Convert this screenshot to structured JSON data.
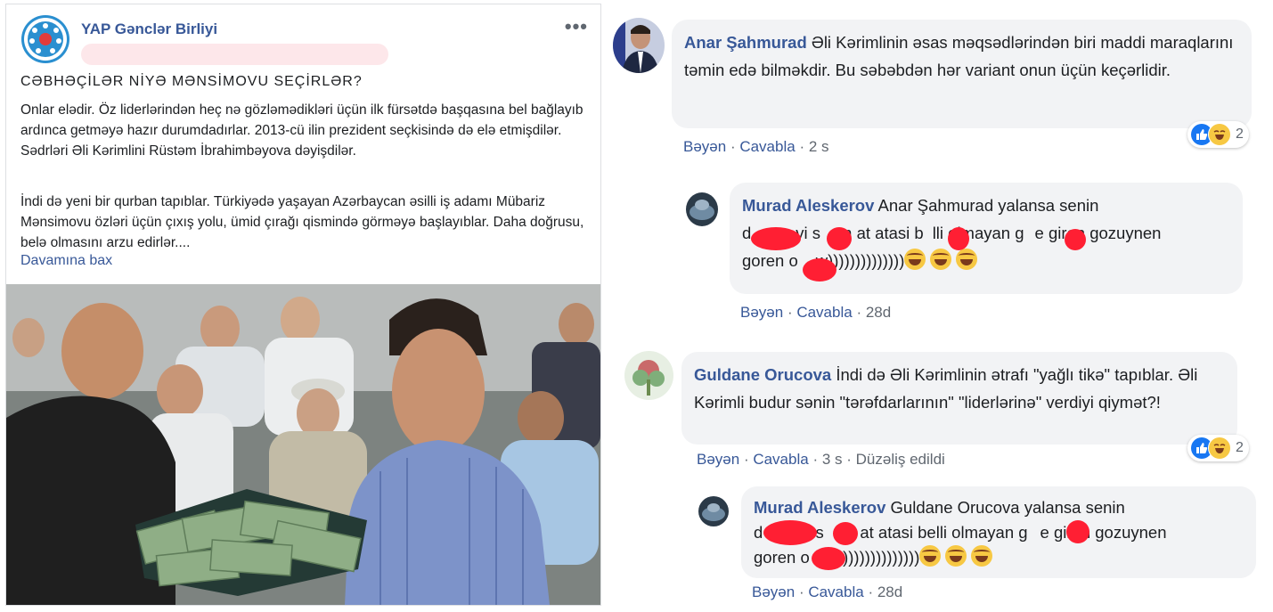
{
  "post": {
    "page_name": "YAP Gənclər Birliyi",
    "more_icon": "more-horizontal-icon",
    "headline": "CƏBHƏÇİLƏR NİYƏ MƏNSİMOVU SEÇİRLƏR?",
    "paragraph1": "Onlar elədir. Öz liderlərindən heç nə gözləmədikləri üçün ilk fürsətdə başqasına bel bağlayıb ardınca getməyə hazır durumdadırlar. 2013-cü ilin prezident seçkisində də elə etmişdilər. Sədrləri Əli Kərimlini Rüstəm İbrahimbəyova dəyişdilər.",
    "paragraph2": "İndi də yeni bir qurban tapıblar. Türkiyədə yaşayan Azərbaycan əsilli iş adamı Mübariz Mənsimovu özləri üçün çıxış yolu, ümid çırağı qismində görməyə başlayıblar. Daha doğrusu, belə olmasını arzu edirlər....",
    "see_more": "Davamına bax"
  },
  "comments": [
    {
      "author": "Anar Şahmurad",
      "text": "Əli Kərimlinin əsas məqsədlərindən biri maddi maraqlarını təmin edə bilməkdir. Bu səbəbdən hər variant onun üçün keçərlidir.",
      "like": "Bəyən",
      "reply": "Cavabla",
      "time": "2 s",
      "reaction_count": "2"
    },
    {
      "author": "Murad Aleskerov",
      "mention": "Anar Şahmurad",
      "line1": "yalansa senin",
      "line2_a": "d",
      "line2_b": "vi s",
      "line2_c": "m at atasi b",
      "line2_d": "lli olmayan g",
      "line2_e": "e giren gozuynen",
      "line3_a": "goren o",
      "line3_b": "w))))))))))))))",
      "like": "Bəyən",
      "reply": "Cavabla",
      "time": "28d"
    },
    {
      "author": "Guldane Orucova",
      "text": "İndi də Əli Kərimlinin ətrafı \"yağlı tikə\" tapıblar. Əli Kərimli budur sənin \"tərəfdarlarının\" \"liderlərinə\" verdiyi qiymət?!",
      "like": "Bəyən",
      "reply": "Cavabla",
      "time": "3 s",
      "edited": "Düzəliş edildi",
      "reaction_count": "2"
    },
    {
      "author": "Murad Aleskerov",
      "mention": "Guldane Orucova",
      "line1": "yalansa senin",
      "line2_a": "d",
      "line2_b": "i s",
      "line2_c": "m at atasi belli olmayan g",
      "line2_d": "e giren gozuynen",
      "line3_a": "goren o",
      "line3_b": "w))))))))))))))",
      "like": "Bəyən",
      "reply": "Cavabla",
      "time": "28d"
    }
  ]
}
